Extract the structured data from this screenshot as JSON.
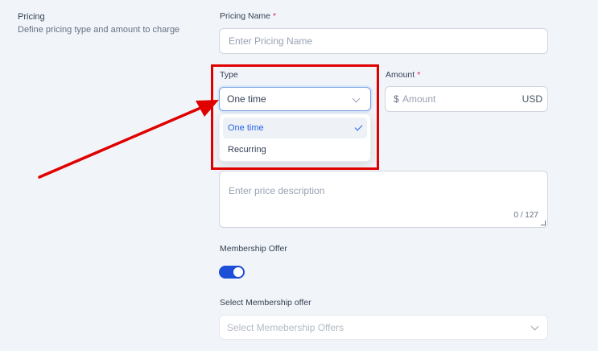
{
  "section": {
    "title": "Pricing",
    "description": "Define pricing type and amount to charge"
  },
  "pricing_name": {
    "label": "Pricing Name",
    "required_mark": "*",
    "placeholder": "Enter Pricing Name"
  },
  "type": {
    "label": "Type",
    "selected": "One time",
    "options": [
      "One time",
      "Recurring"
    ]
  },
  "amount": {
    "label": "Amount",
    "required_mark": "*",
    "currency_symbol": "$",
    "placeholder": "Amount",
    "currency": "USD"
  },
  "description": {
    "placeholder": "Enter price description",
    "counter": "0 / 127"
  },
  "membership_offer": {
    "label": "Membership Offer",
    "enabled": true
  },
  "select_membership": {
    "label": "Select Membership offer",
    "placeholder": "Select Memebership Offers"
  },
  "colors": {
    "accent": "#2563eb",
    "toggle_on": "#1d4ed8",
    "annotation": "#e00000",
    "background": "#f1f5f9"
  },
  "icons": {
    "dropdown": "chevron-down-icon",
    "selected": "check-icon",
    "annotation": "arrow-annotation"
  }
}
